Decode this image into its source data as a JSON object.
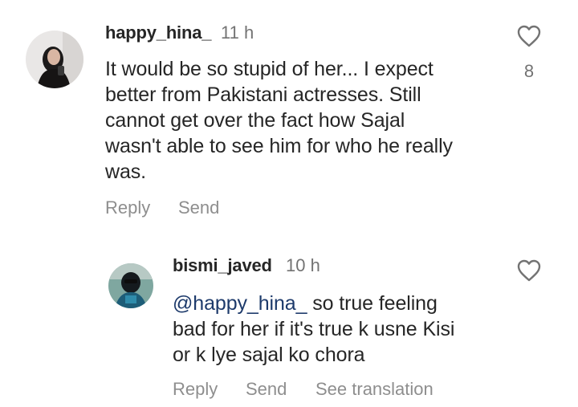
{
  "comments": [
    {
      "username": "happy_hina_",
      "time": "11 h",
      "text": "It would be so stupid of her... I expect better from Pakistani actresses. Still cannot get over the fact how Sajal wasn't able to see him for who he really was.",
      "lines": [
        "It would be so stupid of her... I expect",
        "better from Pakistani actresses. Still",
        "cannot get over the fact how Sajal",
        "wasn't able to see him for who he really",
        "was."
      ],
      "actions": {
        "reply": "Reply",
        "send": "Send"
      },
      "likes": "8",
      "like_icon": "heart-outline-icon"
    },
    {
      "username": "bismi_javed",
      "time": "10 h",
      "mention": "@happy_hina_",
      "lines": [
        " so true feeling",
        "bad for her if it's true k usne Kisi",
        "or k lye sajal ko chora"
      ],
      "actions": {
        "reply": "Reply",
        "send": "Send",
        "translate": "See translation"
      },
      "like_icon": "heart-outline-icon"
    }
  ],
  "colors": {
    "text": "#262626",
    "muted": "#737373",
    "action": "#8e8e8e",
    "mention": "#1d3a6b"
  }
}
